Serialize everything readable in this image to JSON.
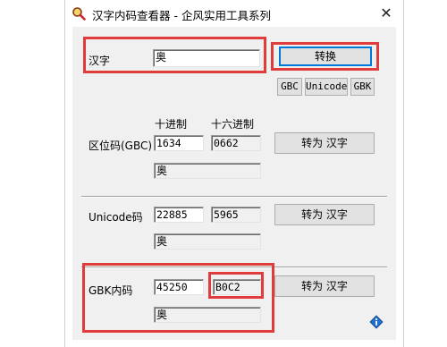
{
  "window": {
    "title": "汉字内码查看器 - 企风实用工具系列",
    "close": "✕"
  },
  "icons": {
    "app": "magnifier-icon",
    "info": "info-icon"
  },
  "hanzi": {
    "label": "汉字",
    "value": "奥",
    "convert": "转换"
  },
  "encodings": [
    "GBC",
    "Unicode",
    "GBK"
  ],
  "headers": {
    "decimal": "十进制",
    "hex": "十六进制"
  },
  "gb": {
    "label": "区位码(GBC)",
    "decimal": "1634",
    "hex": "0662",
    "button": "转为 汉字",
    "result": "奥"
  },
  "unicode": {
    "label": "Unicode码",
    "decimal": "22885",
    "hex": "5965",
    "button": "转为 汉字",
    "result": "奥"
  },
  "gbk": {
    "label": "GBK内码",
    "decimal": "45250",
    "hex": "B0C2",
    "button": "转为 汉字",
    "result": "奥"
  },
  "colors": {
    "highlight": "#e03c3c",
    "focus": "#0078d7"
  }
}
